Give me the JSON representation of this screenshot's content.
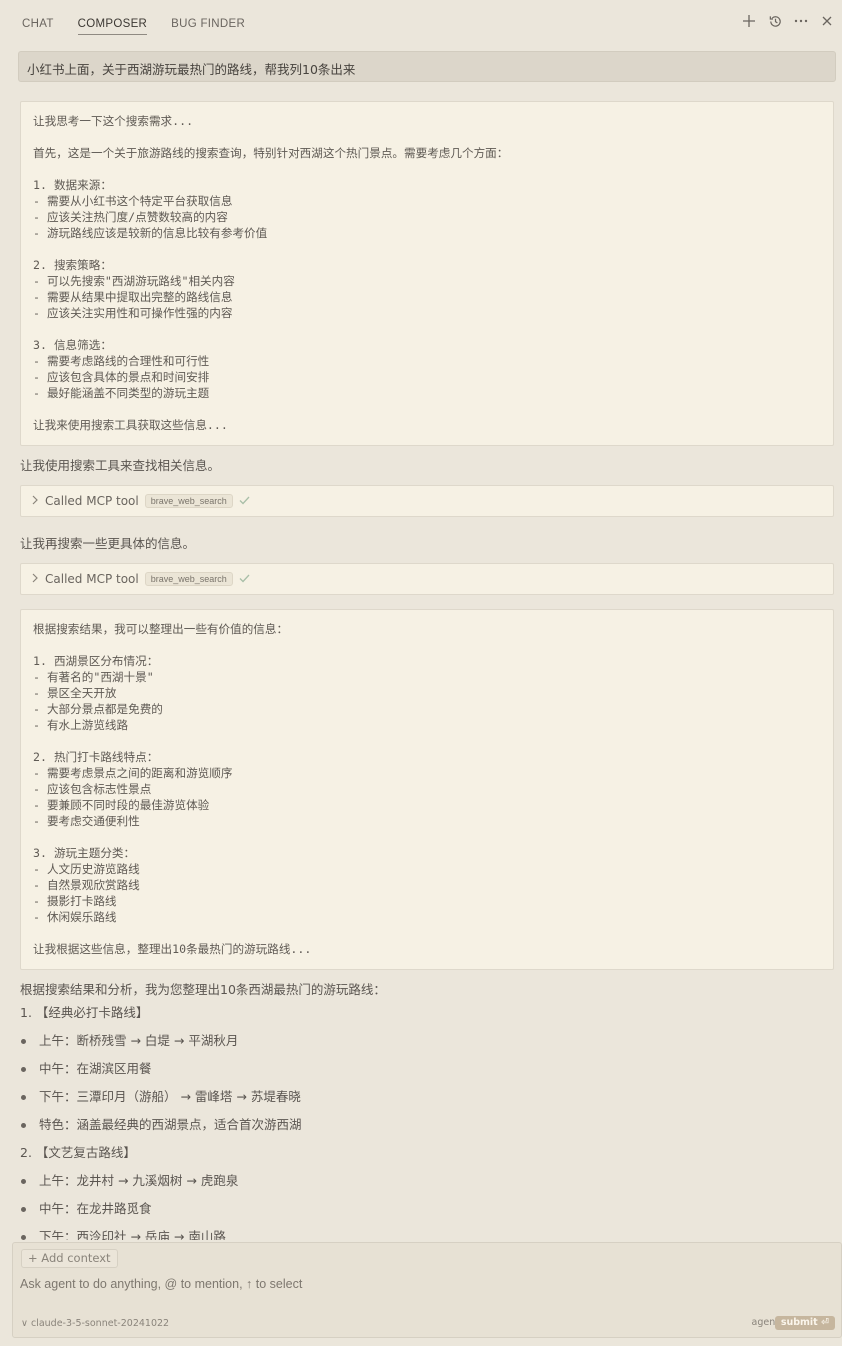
{
  "tabs": [
    "CHAT",
    "COMPOSER",
    "BUG FINDER"
  ],
  "query": "小红书上面，关于西湖游玩最热门的路线，帮我列10条出来",
  "think1": [
    "让我思考一下这个搜索需求...",
    "",
    "首先，这是一个关于旅游路线的搜索查询，特别针对西湖这个热门景点。需要考虑几个方面：",
    "",
    "1. 数据来源：",
    "- 需要从小红书这个特定平台获取信息",
    "- 应该关注热门度/点赞数较高的内容",
    "- 游玩路线应该是较新的信息比较有参考价值",
    "",
    "2. 搜索策略：",
    "- 可以先搜索\"西湖游玩路线\"相关内容",
    "- 需要从结果中提取出完整的路线信息",
    "- 应该关注实用性和可操作性强的内容",
    "",
    "3. 信息筛选：",
    "- 需要考虑路线的合理性和可行性",
    "- 应该包含具体的景点和时间安排",
    "- 最好能涵盖不同类型的游玩主题",
    "",
    "让我来使用搜索工具获取这些信息..."
  ],
  "msg1": "让我使用搜索工具来查找相关信息。",
  "tool_label": "Called MCP tool",
  "tool_name": "brave_web_search",
  "msg2": "让我再搜索一些更具体的信息。",
  "think2": [
    "根据搜索结果，我可以整理出一些有价值的信息：",
    "",
    "1. 西湖景区分布情况：",
    "- 有著名的\"西湖十景\"",
    "- 景区全天开放",
    "- 大部分景点都是免费的",
    "- 有水上游览线路",
    "",
    "2. 热门打卡路线特点：",
    "- 需要考虑景点之间的距离和游览顺序",
    "- 应该包含标志性景点",
    "- 要兼顾不同时段的最佳游览体验",
    "- 要考虑交通便利性",
    "",
    "3. 游玩主题分类：",
    "- 人文历史游览路线",
    "- 自然景观欣赏路线",
    "- 摄影打卡路线",
    "- 休闲娱乐路线",
    "",
    "让我根据这些信息，整理出10条最热门的游玩路线..."
  ],
  "result": {
    "intro": "根据搜索结果和分析，我为您整理出10条西湖最热门的游玩路线：",
    "rows": [
      {
        "kind": "head",
        "text": "1. 【经典必打卡路线】"
      },
      {
        "kind": "bullet",
        "text": "上午：断桥残雪 → 白堤 → 平湖秋月"
      },
      {
        "kind": "bullet",
        "text": "中午：在湖滨区用餐"
      },
      {
        "kind": "bullet",
        "text": "下午：三潭印月（游船） → 雷峰塔 → 苏堤春晓"
      },
      {
        "kind": "bullet",
        "text": "特色：涵盖最经典的西湖景点，适合首次游西湖"
      },
      {
        "kind": "head",
        "text": "2. 【文艺复古路线】"
      },
      {
        "kind": "bullet",
        "text": "上午：龙井村 → 九溪烟树 → 虎跑泉"
      },
      {
        "kind": "bullet",
        "text": "中午：在龙井路觅食"
      },
      {
        "kind": "bullet",
        "text": "下午：西泠印社 → 岳庙 → 南山路"
      }
    ]
  },
  "composer": {
    "add_context": "+ Add context",
    "placeholder": "Ask agent to do anything, @ to mention, ↑ to select",
    "model": "∨ claude-3-5-sonnet-20241022",
    "mode": "agent",
    "submit": "submit ⏎"
  },
  "icons": [
    "plus-icon",
    "history-icon",
    "more-icon",
    "close-icon"
  ]
}
